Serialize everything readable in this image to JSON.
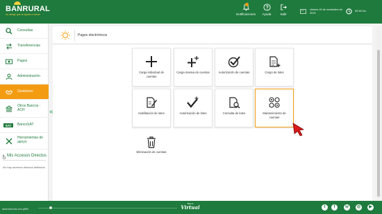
{
  "header": {
    "logo_text": "BANRURAL",
    "logo_tagline": "Un amigo que te ayuda a crecer",
    "notifications_label": "Notificaciones",
    "help_label": "Ayuda",
    "exit_label": "Salir",
    "date_text": "viernes 15 de noviembre de 2019",
    "time_text": "09:16 hrs"
  },
  "sidebar": {
    "items": [
      {
        "label": "Consultas",
        "icon": "search-icon"
      },
      {
        "label": "Transferencias",
        "icon": "transfer-icon"
      },
      {
        "label": "Pagos",
        "icon": "money-icon"
      },
      {
        "label": "Administración",
        "icon": "admin-icon"
      },
      {
        "label": "Gestiones",
        "icon": "handshake-icon"
      },
      {
        "label": "Otros Bancos - ACH",
        "icon": "bank-icon"
      },
      {
        "label": "BancoSAT",
        "icon": "sat-icon"
      },
      {
        "label": "Herramientas de apoyo",
        "icon": "tools-icon"
      }
    ],
    "shortcuts_title": "Mis Accesos Directos",
    "shortcuts_empty": "No hay accesos directos definidos"
  },
  "main": {
    "title": "Pagos electrónicos",
    "tiles": [
      {
        "label": "Carga individual de cuentas",
        "icon": "plus-icon"
      },
      {
        "label": "Carga masiva de cuentas",
        "icon": "plus-plus-icon"
      },
      {
        "label": "Autorización de cuentas",
        "icon": "check-circle-icon"
      },
      {
        "label": "Cargo de lotes",
        "icon": "document-plus-icon"
      },
      {
        "label": "Habilitación de lotes",
        "icon": "document-edit-icon"
      },
      {
        "label": "Autorización de lotes",
        "icon": "check-plus-icon"
      },
      {
        "label": "Consulta de lotes",
        "icon": "document-search-icon"
      },
      {
        "label": "Mantenimiento de cuentas",
        "icon": "gears-icon"
      },
      {
        "label": "Eliminación de cuentas",
        "icon": "trash-icon"
      }
    ]
  },
  "footer": {
    "url": "www.banrural.com.gt/BV",
    "logo_top": "Banca",
    "logo_bottom": "Virtual",
    "social": [
      "twitter-icon",
      "facebook-icon",
      "whatsapp-icon",
      "instagram-icon",
      "youtube-icon"
    ]
  },
  "colors": {
    "brand_green": "#1f7a3d",
    "accent_orange": "#f39c12",
    "cursor_red": "#d91a1a"
  }
}
